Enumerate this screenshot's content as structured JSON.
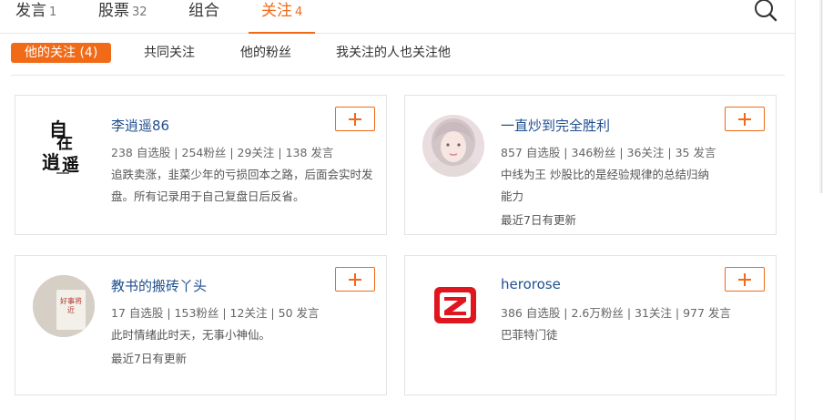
{
  "top_tabs": [
    {
      "label": "发言",
      "count": "1"
    },
    {
      "label": "股票",
      "count": "32"
    },
    {
      "label": "组合",
      "count": ""
    },
    {
      "label": "关注",
      "count": "4"
    }
  ],
  "sub_tabs": [
    "他的关注 (4)",
    "共同关注",
    "他的粉丝",
    "我关注的人也关注他"
  ],
  "cards": [
    {
      "name": "李逍遥86",
      "stats": "238 自选股 | 254粉丝 | 29关注 | 138 发言",
      "desc": "追跌卖涨，韭菜少年的亏损回本之路，后面会实时发盘。所有记录用于自己复盘日后反省。",
      "update": "",
      "avatar_text": [
        "自",
        "在",
        "逍",
        "遥"
      ]
    },
    {
      "name": "一直炒到完全胜利",
      "stats": "857 自选股 | 346粉丝 | 36关注 | 35 发言",
      "desc": "中线为王 炒股比的是经验规律的总结归纳能力",
      "update": "最近7日有更新"
    },
    {
      "name": "教书的搬砖丫头",
      "stats": "17 自选股 | 153粉丝 | 12关注 | 50 发言",
      "desc": "此时情绪此时天，无事小神仙。",
      "update": "最近7日有更新",
      "avatar_text": "好事将近"
    },
    {
      "name": "herorose",
      "stats": "386 自选股 | 2.6万粉丝 | 31关注 | 977 发言",
      "desc": "巴菲特门徒",
      "update": ""
    }
  ],
  "colors": {
    "accent": "#f06a18",
    "link": "#1f4f8f",
    "logo_red": "#e0161e"
  }
}
